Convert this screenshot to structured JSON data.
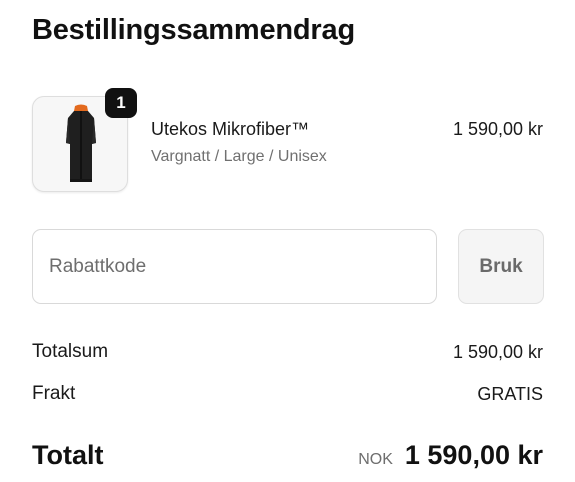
{
  "summary": {
    "title": "Bestillingssammendrag"
  },
  "product": {
    "quantity": "1",
    "name": "Utekos Mikrofiber™",
    "variant": "Vargnatt / Large / Unisex",
    "price": "1 590,00 kr",
    "image_icon": "jacket-product-image",
    "accent_color": "#e36a1e"
  },
  "discount": {
    "placeholder": "Rabattkode",
    "value": "",
    "apply_label": "Bruk"
  },
  "totals": {
    "subtotal_label": "Totalsum",
    "subtotal_value": "1 590,00 kr",
    "shipping_label": "Frakt",
    "shipping_value": "GRATIS",
    "total_label": "Totalt",
    "currency": "NOK",
    "total_value": "1 590,00 kr"
  }
}
